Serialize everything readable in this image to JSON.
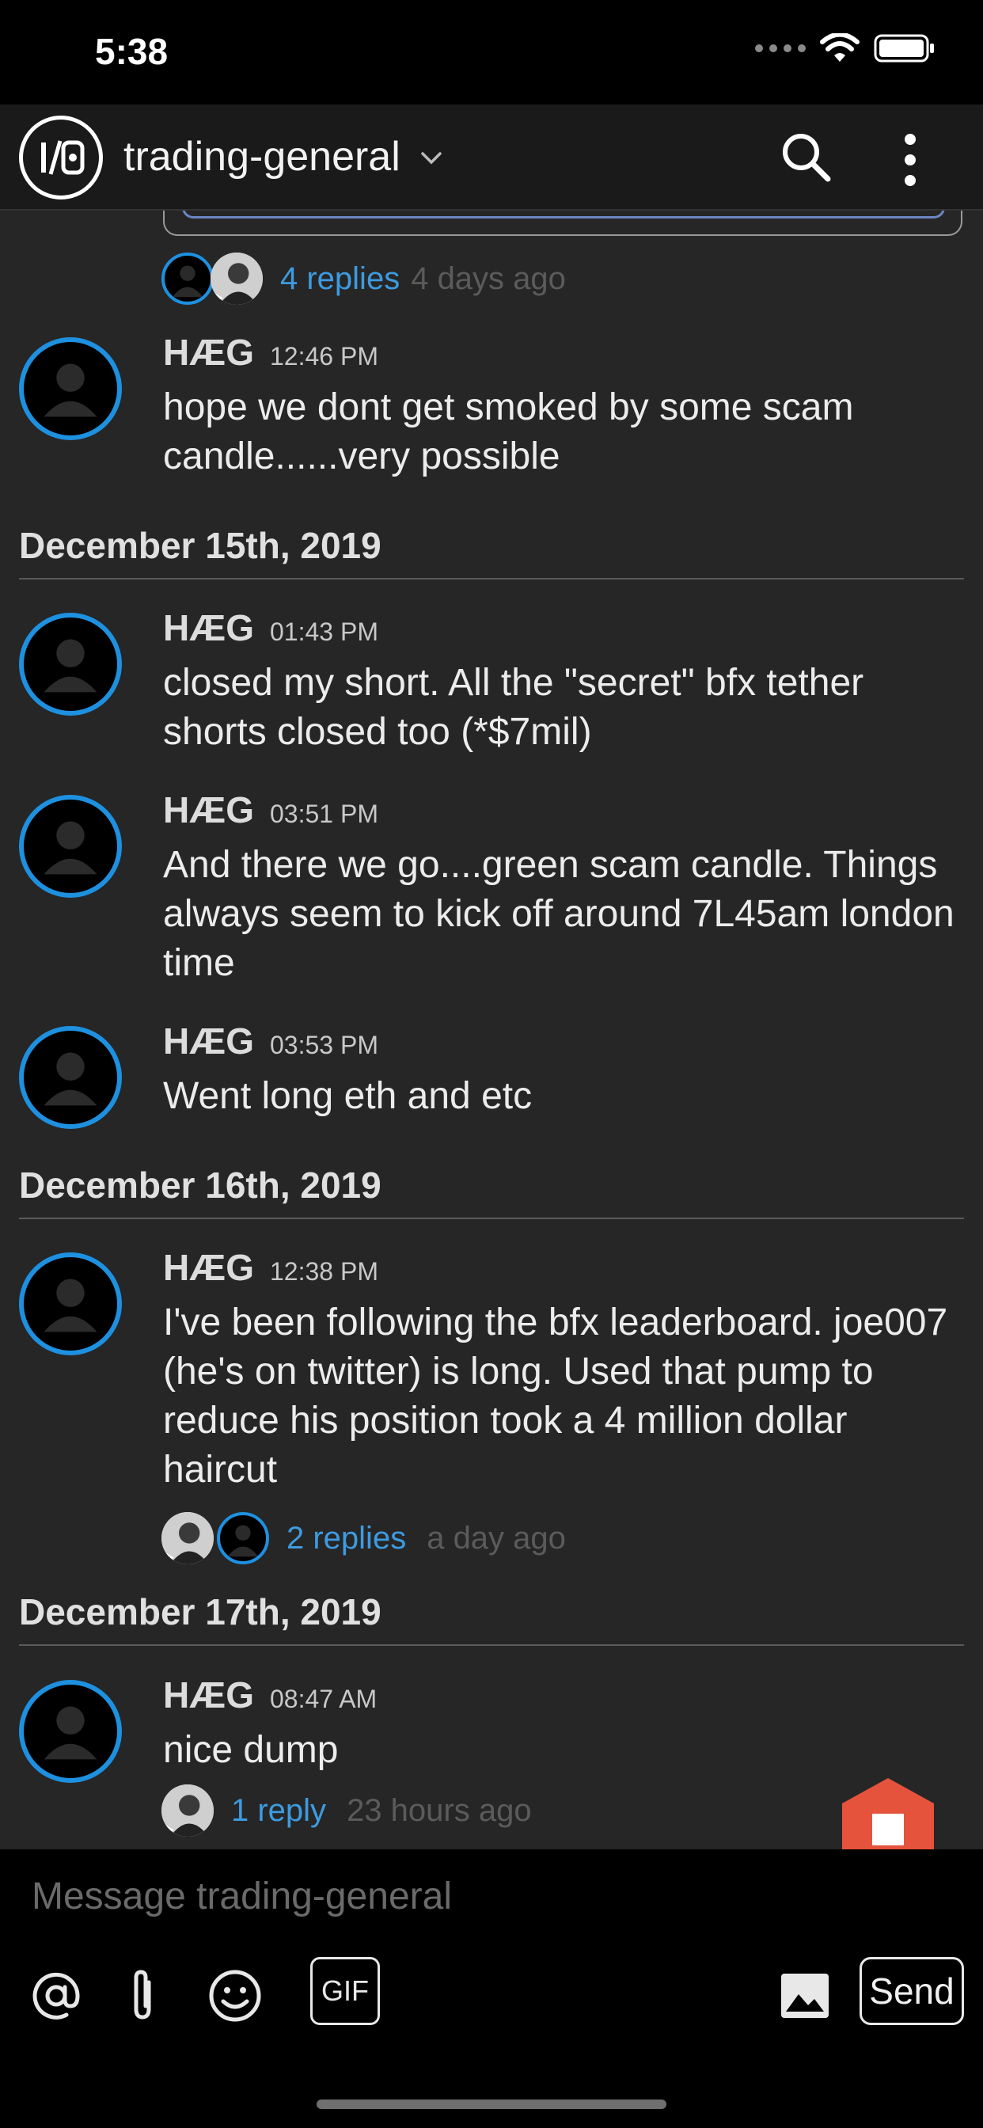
{
  "status": {
    "time": "5:38"
  },
  "header": {
    "channel": "trading-general"
  },
  "top_thread": {
    "replies": "4 replies",
    "time": "4 days ago"
  },
  "messages": [
    {
      "author": "HÆG",
      "time": "12:46 PM",
      "text": "hope we dont get smoked by some scam candle......very possible"
    },
    {
      "date": "December 15th, 2019"
    },
    {
      "author": "HÆG",
      "time": "01:43 PM",
      "text": "closed my short. All the \"secret\" bfx tether shorts closed too (*$7mil)"
    },
    {
      "author": "HÆG",
      "time": "03:51 PM",
      "text": "And there we go....green scam  candle. Things always seem to kick off around 7L45am london time"
    },
    {
      "author": "HÆG",
      "time": "03:53 PM",
      "text": "Went long eth and etc"
    },
    {
      "date": "December 16th, 2019"
    },
    {
      "author": "HÆG",
      "time": "12:38 PM",
      "text": "I've been following the bfx leaderboard. joe007 (he's on twitter) is long. Used that pump to reduce his position took a 4 million dollar haircut",
      "thread": {
        "replies": "2 replies",
        "time": "a day ago"
      }
    },
    {
      "date": "December 17th, 2019"
    },
    {
      "author": "HÆG",
      "time": "08:47 AM",
      "text": "nice dump",
      "thread": {
        "replies": "1 reply",
        "time": "23 hours ago"
      }
    }
  ],
  "composer": {
    "placeholder": "Message trading-general",
    "gif_label": "GIF",
    "send_label": "Send"
  },
  "colors": {
    "accent": "#1e90e0",
    "link": "#3d9be0",
    "fab": "#e5533d",
    "background": "#262626"
  }
}
